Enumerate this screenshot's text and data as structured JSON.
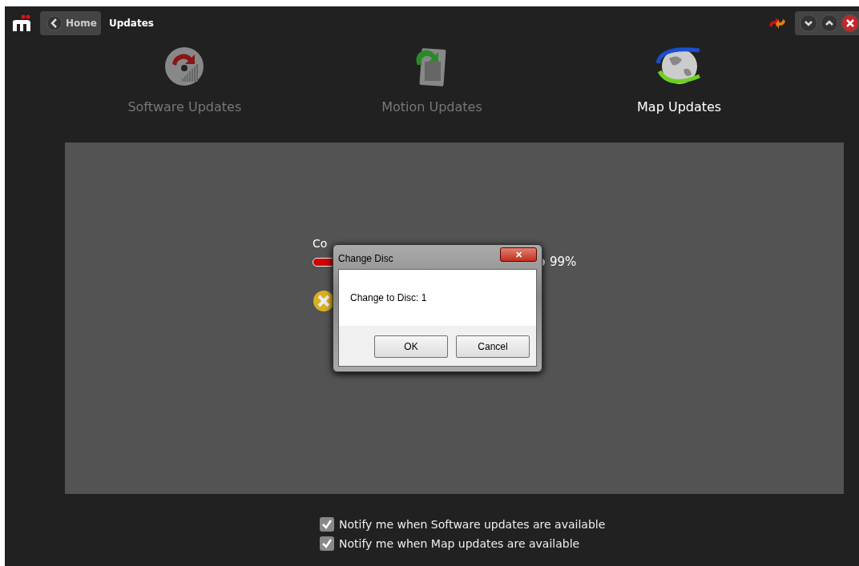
{
  "header": {
    "back_label": "Home",
    "title": "Updates"
  },
  "tabs": [
    {
      "label": "Software Updates",
      "selected": false,
      "kind": "software"
    },
    {
      "label": "Motion Updates",
      "selected": false,
      "kind": "motion"
    },
    {
      "label": "Map Updates",
      "selected": true,
      "kind": "map"
    }
  ],
  "progress": {
    "label": "Co",
    "level": 0.99,
    "reading": "99%"
  },
  "dialog": {
    "title": "Change Disc",
    "close": "✕",
    "message": "Change to Disc: 1",
    "buttons": [
      "OK",
      "Cancel"
    ]
  },
  "options": [
    {
      "label": "Notify me when Software updates are available",
      "checked": true
    },
    {
      "label": "Notify me when Map updates are available",
      "checked": true
    }
  ]
}
